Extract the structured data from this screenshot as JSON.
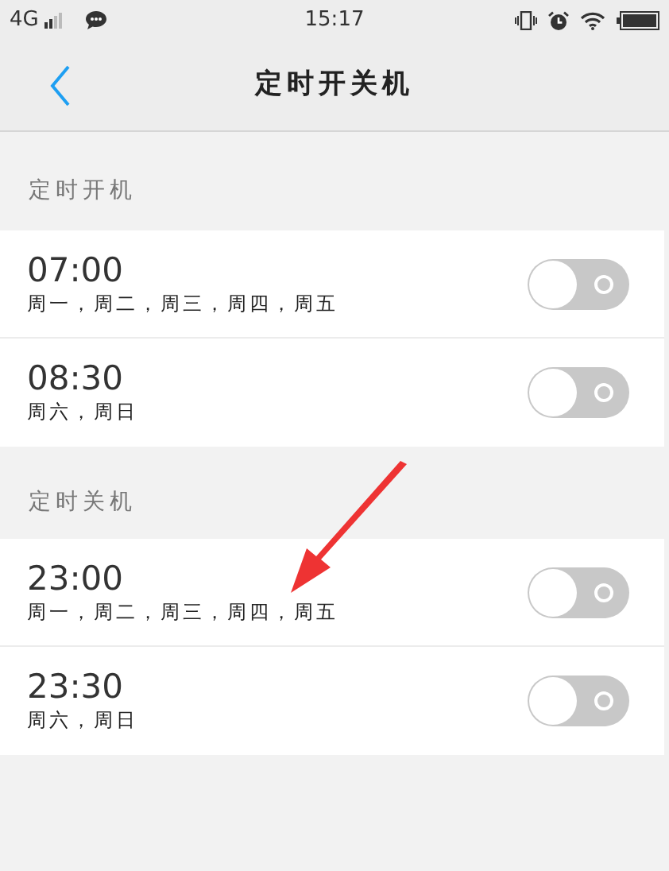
{
  "status_bar": {
    "network": "4G",
    "time": "15:17"
  },
  "header": {
    "title": "定时开关机"
  },
  "sections": [
    {
      "title": "定时开机",
      "items": [
        {
          "time": "07:00",
          "days": "周一，周二，周三，周四，周五",
          "on": false
        },
        {
          "time": "08:30",
          "days": "周六，周日",
          "on": false
        }
      ]
    },
    {
      "title": "定时关机",
      "items": [
        {
          "time": "23:00",
          "days": "周一，周二，周三，周四，周五",
          "on": false
        },
        {
          "time": "23:30",
          "days": "周六，周日",
          "on": false
        }
      ]
    }
  ]
}
